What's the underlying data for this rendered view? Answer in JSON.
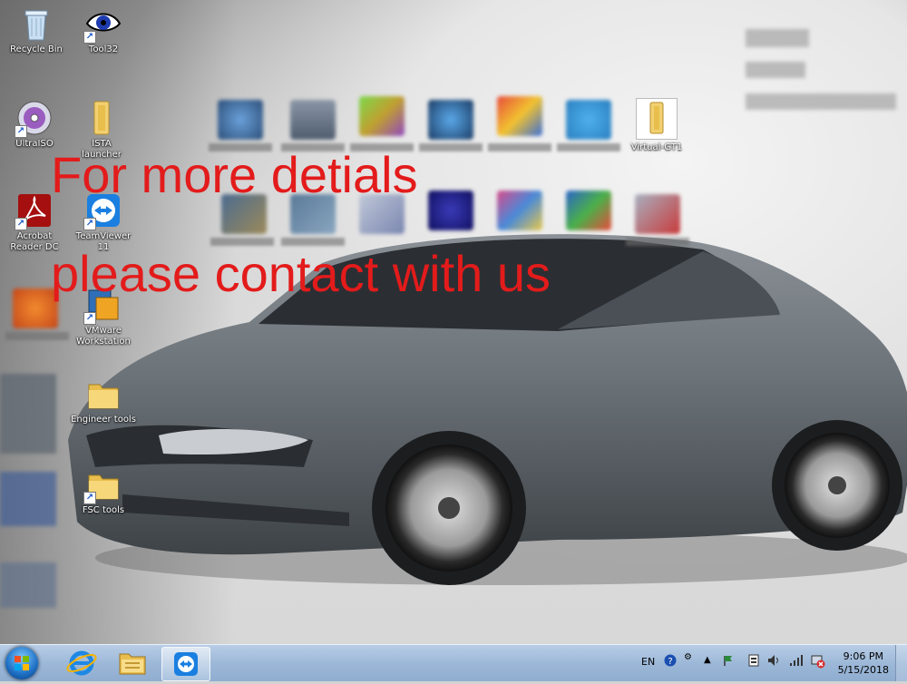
{
  "desktop": {
    "icons": {
      "recycle_bin": "Recycle Bin",
      "tool32": "Tool32",
      "ultraiso": "UltraISO",
      "ista": "ISTA",
      "ista_sub": "launcher",
      "acrobat": "Acrobat Reader DC",
      "teamviewer": "TeamViewer 11",
      "vmware": "VMware Workstation",
      "engineer_tools": "Engineer tools",
      "fsc_tools": "FSC tools",
      "virtual_gt1": "Virtual-GT1"
    },
    "watermark": {
      "line1": "For more detials",
      "line2": "please contact with us"
    }
  },
  "taskbar": {
    "language": "EN",
    "time": "9:06 PM",
    "date": "5/15/2018"
  },
  "colors": {
    "watermark": "#e31b1b",
    "taskbar": "#9db8d8",
    "car": "#6b7278"
  }
}
